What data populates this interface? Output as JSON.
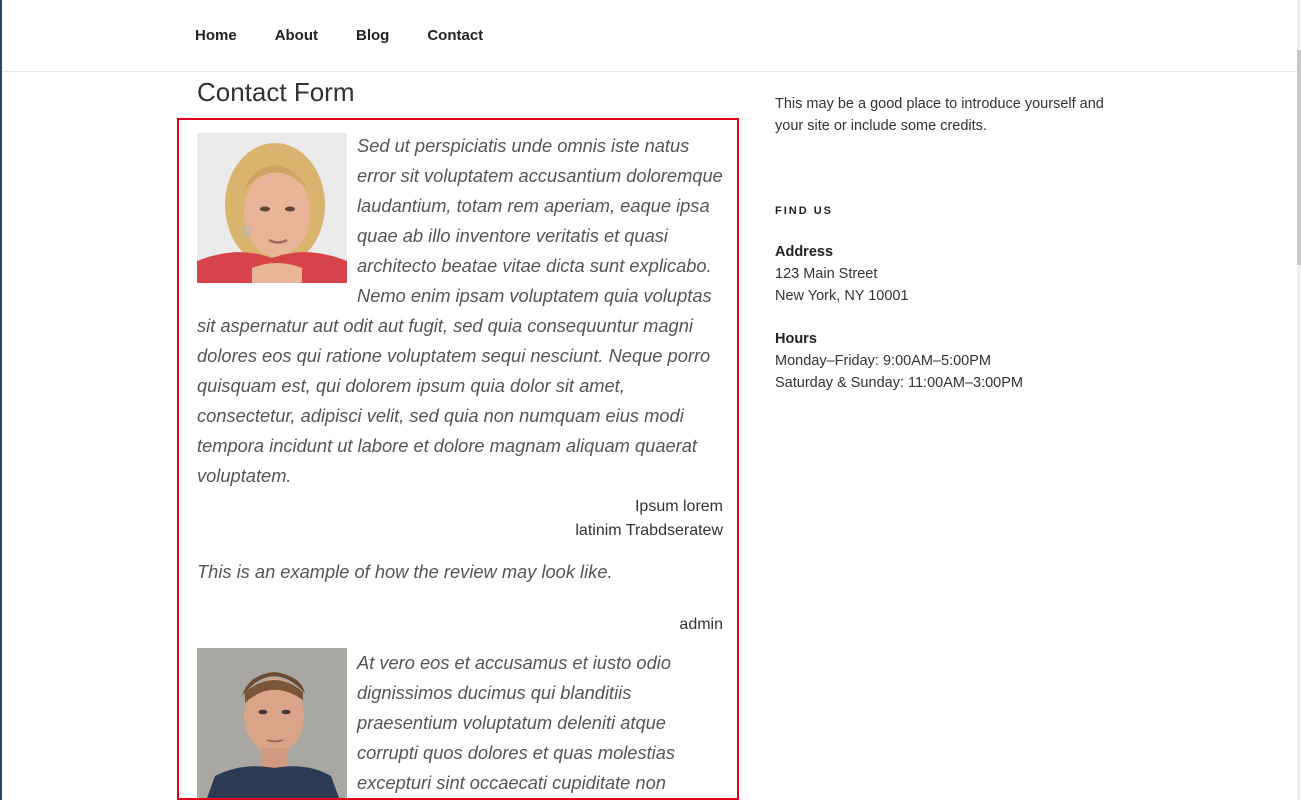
{
  "nav": {
    "items": [
      {
        "label": "Home"
      },
      {
        "label": "About"
      },
      {
        "label": "Blog"
      },
      {
        "label": "Contact"
      }
    ]
  },
  "page": {
    "title": "Contact Form"
  },
  "reviews": [
    {
      "text": "Sed ut perspiciatis unde omnis iste natus error sit voluptatem accusantium doloremque laudantium, totam rem aperiam, eaque ipsa quae ab illo inventore veritatis et quasi architecto beatae vitae dicta sunt explicabo. Nemo enim ipsam voluptatem quia voluptas sit aspernatur aut odit aut fugit, sed quia consequuntur magni dolores eos qui ratione voluptatem sequi nesciunt. Neque porro quisquam est, qui dolorem ipsum quia dolor sit amet, consectetur, adipisci velit, sed quia non numquam eius modi tempora incidunt ut labore et dolore magnam aliquam quaerat voluptatem.",
      "author_line1": "Ipsum lorem",
      "author_line2": "latinim Trabdseratew"
    },
    {
      "text": "This is an example of how the review may look like.",
      "author_line1": "admin"
    },
    {
      "text": "At vero eos et accusamus et iusto odio dignissimos ducimus qui blanditiis praesentium voluptatum deleniti atque corrupti quos dolores et quas molestias excepturi sint occaecati cupiditate non provident, similique sunt in culpa qui officia"
    }
  ],
  "sidebar": {
    "intro": "This may be a good place to introduce yourself and your site or include some credits.",
    "widget_title": "FIND US",
    "address_heading": "Address",
    "address_line1": "123 Main Street",
    "address_line2": "New York, NY 10001",
    "hours_heading": "Hours",
    "hours_line1": "Monday–Friday: 9:00AM–5:00PM",
    "hours_line2": "Saturday & Sunday: 11:00AM–3:00PM"
  }
}
